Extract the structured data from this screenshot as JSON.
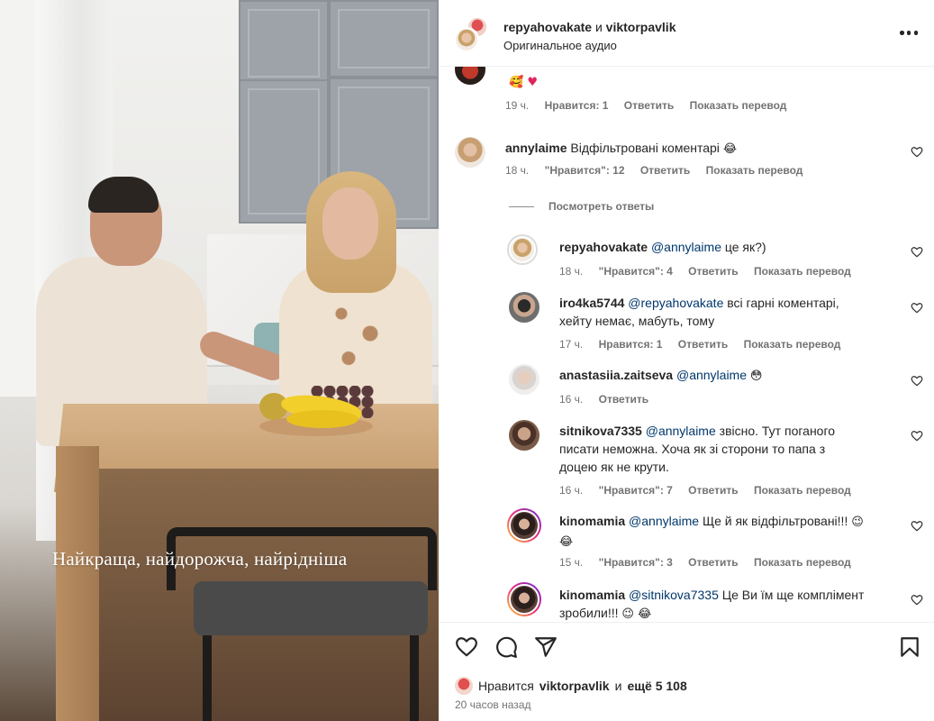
{
  "media": {
    "caption": "Найкраща, найдорожча, найрідніша"
  },
  "header": {
    "user1": "repyahovakate",
    "conj": "и",
    "user2": "viktorpavlik",
    "audio": "Оригинальное аудио"
  },
  "comments": [
    {
      "id": "c0",
      "text_emoji": "🥰 ♥",
      "time": "19 ч.",
      "likes": "Нравится: 1",
      "reply": "Ответить",
      "translate": "Показать перевод"
    },
    {
      "id": "c1",
      "user": "annylaime",
      "text": "Відфільтровані коментарі",
      "emoji": "😂",
      "time": "18 ч.",
      "likes": "\"Нравится\": 12",
      "reply": "Ответить",
      "translate": "Показать перевод"
    },
    {
      "id": "r1",
      "user": "repyahovakate",
      "mention": "@annylaime",
      "text": "це як?)",
      "time": "18 ч.",
      "likes": "\"Нравится\": 4",
      "reply": "Ответить",
      "translate": "Показать перевод"
    },
    {
      "id": "r2",
      "user": "iro4ka5744",
      "mention": "@repyahovakate",
      "text": "всі гарні коментарі,",
      "text2": "хейту немає, мабуть, тому",
      "time": "17 ч.",
      "likes": "Нравится: 1",
      "reply": "Ответить",
      "translate": "Показать перевод"
    },
    {
      "id": "r3",
      "user": "anastasiia.zaitseva",
      "mention": "@annylaime",
      "emoji": "😳",
      "time": "16 ч.",
      "reply": "Ответить"
    },
    {
      "id": "r4",
      "user": "sitnikova7335",
      "mention": "@annylaime",
      "text": "звісно. Тут поганого",
      "text2": "писати неможна. Хоча як зі сторони то папа з",
      "text3": "доцею як не крути.",
      "time": "16 ч.",
      "likes": "\"Нравится\": 7",
      "reply": "Ответить",
      "translate": "Показать перевод"
    },
    {
      "id": "r5",
      "user": "kinomamia",
      "mention": "@annylaime",
      "text": "Ще й як відфільтровані!!!",
      "emoji": "😉",
      "emoji2": "😂",
      "time": "15 ч.",
      "likes": "\"Нравится\": 3",
      "reply": "Ответить",
      "translate": "Показать перевод"
    },
    {
      "id": "r6",
      "user": "kinomamia",
      "mention": "@sitnikova7335",
      "text": "Це Ви їм ще комплімент",
      "text2": "зробили!!!",
      "emoji": "😉 😂"
    }
  ],
  "view_replies": "Посмотреть ответы",
  "footer": {
    "likes_prefix": "Нравится",
    "likes_user": "viktorpavlik",
    "likes_and": "и",
    "likes_count": "ещё 5 108",
    "time_ago": "20 часов назад"
  }
}
